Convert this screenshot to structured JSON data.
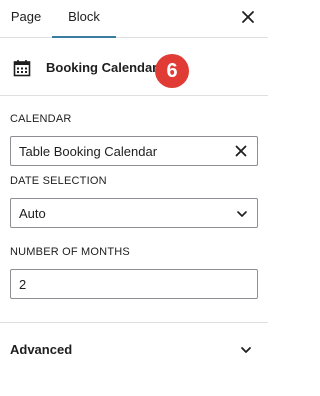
{
  "tabs": [
    {
      "label": "Page"
    },
    {
      "label": "Block"
    }
  ],
  "block": {
    "title": "Booking Calendar",
    "badge": "6",
    "icon": "calendar-icon"
  },
  "calendar": {
    "label": "CALENDAR",
    "value": "Table Booking Calendar"
  },
  "date_selection": {
    "label": "DATE SELECTION",
    "value": "Auto"
  },
  "months": {
    "label": "NUMBER OF MONTHS",
    "value": "2"
  },
  "advanced": {
    "label": "Advanced"
  },
  "colors": {
    "accent": "#3b7ca0",
    "badge": "#e03c35",
    "border": "#8c8f94",
    "divider": "#e0e0e0"
  }
}
